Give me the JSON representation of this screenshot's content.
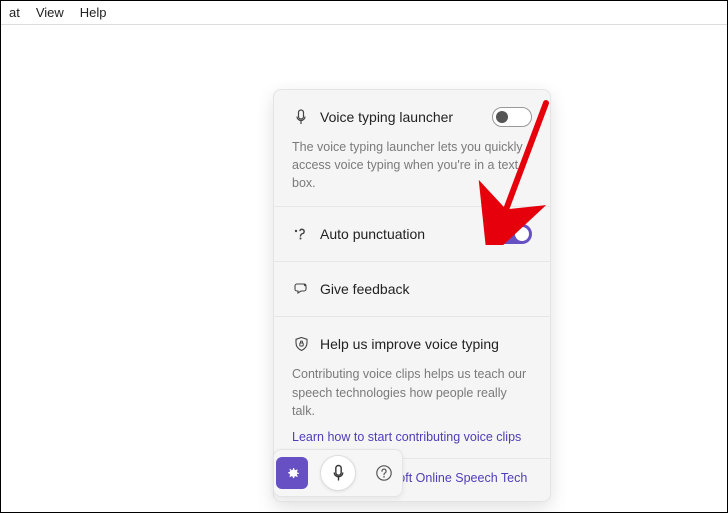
{
  "menubar": {
    "items": [
      "at",
      "View",
      "Help"
    ]
  },
  "panel": {
    "launcher": {
      "label": "Voice typing launcher",
      "desc": "The voice typing launcher lets you quickly access voice typing when you're in a text box.",
      "enabled": false
    },
    "autopunct": {
      "label": "Auto punctuation",
      "enabled": true
    },
    "feedback": {
      "label": "Give feedback"
    },
    "improve": {
      "label": "Help us improve voice typing",
      "desc": "Contributing voice clips helps us teach our speech technologies how people really talk.",
      "link": "Learn how to start contributing voice clips"
    },
    "footer": "Powered by Microsoft Online Speech Tech"
  },
  "colors": {
    "accent": "#6750c4",
    "arrow": "#e6000c"
  }
}
